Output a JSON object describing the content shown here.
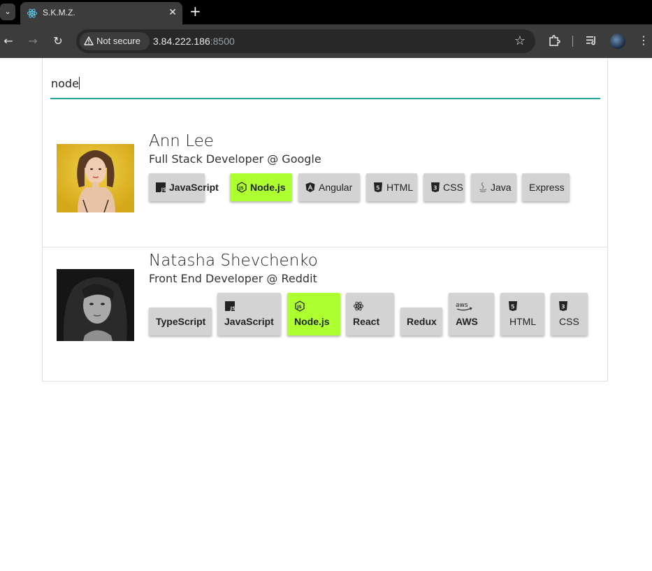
{
  "browser": {
    "tab_title": "S.K.M.Z.",
    "security_label": "Not secure",
    "url_host": "3.84.222.186",
    "url_port": ":8500"
  },
  "search": {
    "value": "node"
  },
  "people": [
    {
      "name": "Ann Lee",
      "title": "Full Stack Developer @ Google",
      "skills": [
        {
          "label": "JavaScript",
          "icon": "javascript-icon",
          "highlighted": false
        },
        {
          "label": "Node.js",
          "icon": "nodejs-icon",
          "highlighted": true
        },
        {
          "label": "Angular",
          "icon": "angular-icon",
          "highlighted": false
        },
        {
          "label": "HTML",
          "icon": "html5-icon",
          "highlighted": false
        },
        {
          "label": "CSS",
          "icon": "css3-icon",
          "highlighted": false
        },
        {
          "label": "Java",
          "icon": "java-icon",
          "highlighted": false
        },
        {
          "label": "Express",
          "icon": "",
          "highlighted": false
        }
      ]
    },
    {
      "name": "Natasha Shevchenko",
      "title": "Front End Developer @ Reddit",
      "skills": [
        {
          "label": "TypeScript",
          "icon": "",
          "highlighted": false
        },
        {
          "label": "JavaScript",
          "icon": "javascript-icon",
          "highlighted": false
        },
        {
          "label": "Node.js",
          "icon": "nodejs-icon",
          "highlighted": true
        },
        {
          "label": "React",
          "icon": "react-icon",
          "highlighted": false
        },
        {
          "label": "Redux",
          "icon": "",
          "highlighted": false
        },
        {
          "label": "AWS",
          "icon": "aws-icon",
          "highlighted": false
        },
        {
          "label": "HTML",
          "icon": "html5-icon",
          "highlighted": false
        },
        {
          "label": "CSS",
          "icon": "css3-icon",
          "highlighted": false
        }
      ]
    }
  ],
  "colors": {
    "accent": "#26a69a",
    "chip_bg": "#d3d3d3",
    "chip_highlight": "#adff2f"
  }
}
